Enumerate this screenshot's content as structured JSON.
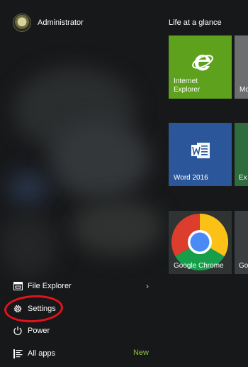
{
  "user": {
    "name": "Administrator",
    "avatar_icon": "user-avatar"
  },
  "left_menu": {
    "items": [
      {
        "label": "File Explorer",
        "icon": "file-explorer-icon",
        "chevron": "›"
      },
      {
        "label": "Settings",
        "icon": "gear-icon"
      },
      {
        "label": "Power",
        "icon": "power-icon"
      },
      {
        "label": "All apps",
        "icon": "list-icon",
        "badge": "New"
      }
    ]
  },
  "tiles": {
    "group_title": "Life at a glance",
    "items": [
      {
        "label": "Internet\nExplorer",
        "icon": "internet-explorer-icon",
        "color": "#5ea11d"
      },
      {
        "label": "Mo",
        "color": "#6c6e6f"
      },
      {
        "label": "Word 2016",
        "icon": "word-icon",
        "color": "#2b579a"
      },
      {
        "label": "Ex",
        "color": "#2e6b3d"
      },
      {
        "label": "Google Chrome",
        "icon": "chrome-icon",
        "color": "#2f3433"
      },
      {
        "label": "Go",
        "color": "#3a3e40"
      }
    ]
  },
  "colors": {
    "menu_background": "#17181a",
    "highlight": "#e3121b",
    "new_badge": "#8fbf3f"
  }
}
